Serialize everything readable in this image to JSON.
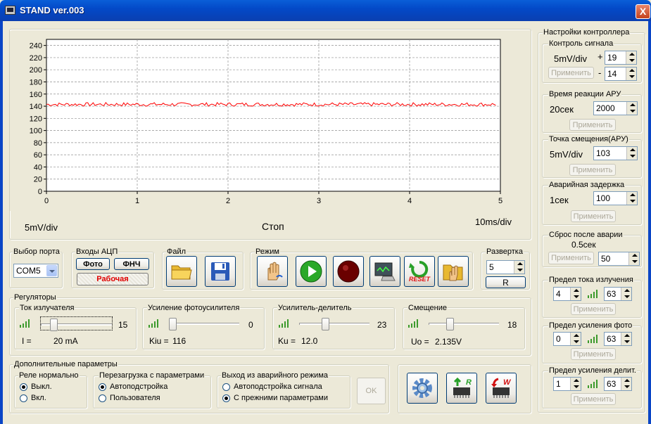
{
  "window": {
    "title": "STAND ver.003",
    "close_glyph": "X"
  },
  "chart_data": {
    "type": "line",
    "xlim": [
      0,
      5
    ],
    "ylim": [
      0,
      250
    ],
    "x_ticks": [
      "0",
      "1",
      "2",
      "3",
      "4",
      "5"
    ],
    "y_ticks": [
      "0",
      "20",
      "40",
      "60",
      "80",
      "100",
      "120",
      "140",
      "160",
      "180",
      "200",
      "220",
      "240"
    ],
    "grid": true,
    "series_color": "#ff0000",
    "baseline": 143,
    "noise_amplitude": 3
  },
  "scope": {
    "left_scale": "5mV/div",
    "status": "Стоп",
    "right_scale": "10ms/div"
  },
  "port": {
    "label": "Выбор порта",
    "value": "COM5"
  },
  "adc": {
    "label": "Входы АЦП",
    "photo": "Фото",
    "lpf": "ФНЧ",
    "mode": "Рабочая"
  },
  "file": {
    "label": "Файл"
  },
  "mode": {
    "label": "Режим",
    "reset_text": "RESET"
  },
  "sweep": {
    "label": "Развертка",
    "value": "5",
    "r_button": "R"
  },
  "regulators": {
    "label": "Регуляторы",
    "current": {
      "label": "Ток излучателя",
      "value": "15",
      "readout_label": "I =",
      "readout_value": "20 mA",
      "level": 15,
      "max": 100
    },
    "photo_gain": {
      "label": "Усиление фотоусилителя",
      "value": "0",
      "readout_label": "Kiu =",
      "readout_value": "116",
      "level": 0,
      "max": 100
    },
    "divider": {
      "label": "Усилитель-делитель",
      "value": "23",
      "readout_label": "Ku =",
      "readout_value": "12.0",
      "level": 23,
      "max": 63
    },
    "offset": {
      "label": "Смещение",
      "value": "18",
      "readout_label": "Uo =",
      "readout_value": "2.135V",
      "level": 18,
      "max": 63
    }
  },
  "extra": {
    "label": "Дополнительные параметры",
    "relay": {
      "label": "Реле нормально",
      "opt1": "Выкл.",
      "opt2": "Вкл."
    },
    "load": {
      "label": "Перезагрузка с параметрами",
      "opt1": "Автоподстройка",
      "opt2": "Пользователя"
    },
    "exit": {
      "label": "Выход из аварийного режима",
      "opt1": "Автоподстройка  сигнала",
      "opt2": "С прежними параметрами"
    },
    "ok": "OK"
  },
  "icons": {
    "read_letter": "R",
    "write_letter": "W"
  },
  "controller": {
    "label": "Настройки контроллера",
    "apply": "Применить",
    "signal": {
      "label": "Контроль сигнала",
      "scale": "5mV/div",
      "plus_sign": "+",
      "plus": "19",
      "minus_sign": "-",
      "minus": "14"
    },
    "agc_time": {
      "label": "Время реакции АРУ",
      "unit": "20сек",
      "value": "2000"
    },
    "agc_point": {
      "label": "Точка смещения(АРУ)",
      "unit": "5mV/div",
      "value": "103"
    },
    "alarm_delay": {
      "label": "Аварийная задержка",
      "unit": "1сек",
      "value": "100"
    },
    "reset_after": {
      "label": "Сброс после аварии",
      "unit": "0.5сек",
      "value": "50"
    },
    "current_limit": {
      "label": "Предел тока излучения",
      "min": "4",
      "max": "63"
    },
    "photo_limit": {
      "label": "Предел усиления фото",
      "min": "0",
      "max": "63"
    },
    "div_limit": {
      "label": "Предел усиления делит.",
      "min": "1",
      "max": "63"
    }
  }
}
